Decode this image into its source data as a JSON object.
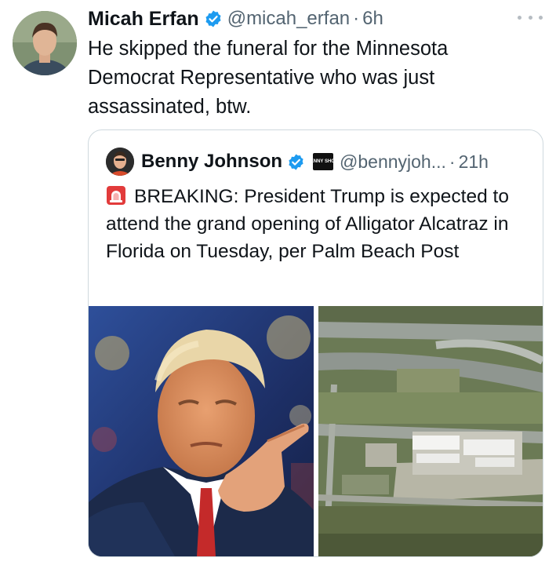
{
  "tweet": {
    "author_name": "Micah Erfan",
    "author_handle": "@micah_erfan",
    "separator": "·",
    "time": "6h",
    "text": "He skipped the funeral for the Minnesota Democrat Representative who was just assassinated, btw.",
    "verified_icon": "verified-badge-icon",
    "more_icon": "more-options-icon"
  },
  "quoted": {
    "author_name": "Benny Johnson",
    "author_handle": "@bennyjoh...",
    "separator": "·",
    "time": "21h",
    "affiliate_logo_text": "BENNY SHOW",
    "siren_icon": "rotating-light-icon",
    "text": "BREAKING: President Trump is expected to attend the grand opening of Alligator Alcatraz in Florida on Tuesday, per Palm Beach Post",
    "media": [
      {
        "kind": "photo",
        "subject": "man-pointing-photo"
      },
      {
        "kind": "photo",
        "subject": "aerial-airfield-photo"
      }
    ]
  },
  "colors": {
    "text": "#0f1419",
    "secondary": "#536471",
    "verified": "#1d9bf0",
    "border": "#cfd9de"
  }
}
